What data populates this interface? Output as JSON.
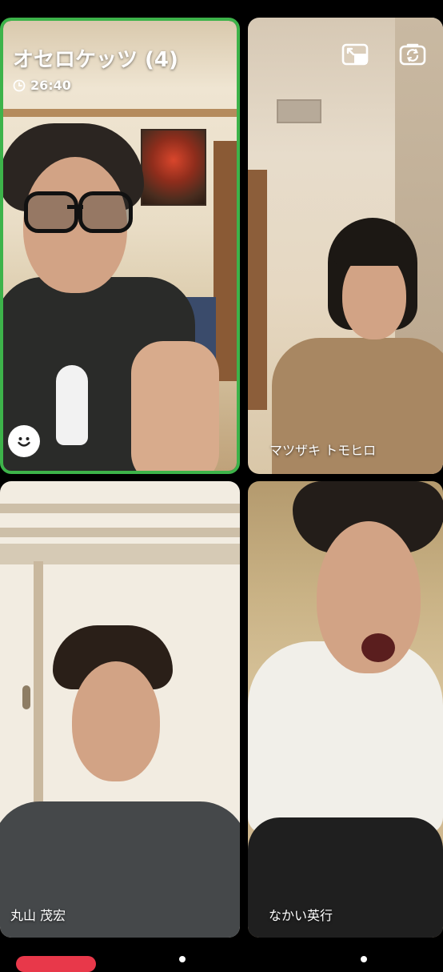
{
  "call": {
    "title": "オセロケッツ (4)",
    "elapsed": "26:40",
    "active_border_color": "#3db34a"
  },
  "participants": [
    {
      "name": ""
    },
    {
      "name": "マツザキ トモヒロ"
    },
    {
      "name": "丸山 茂宏"
    },
    {
      "name": "なかい英行"
    }
  ],
  "icons": {
    "pip": "picture-in-picture-icon",
    "flip": "camera-flip-icon",
    "clock": "clock-icon",
    "emoji": "smiley-icon"
  },
  "controls": {
    "end_call_color": "#e8384a"
  }
}
